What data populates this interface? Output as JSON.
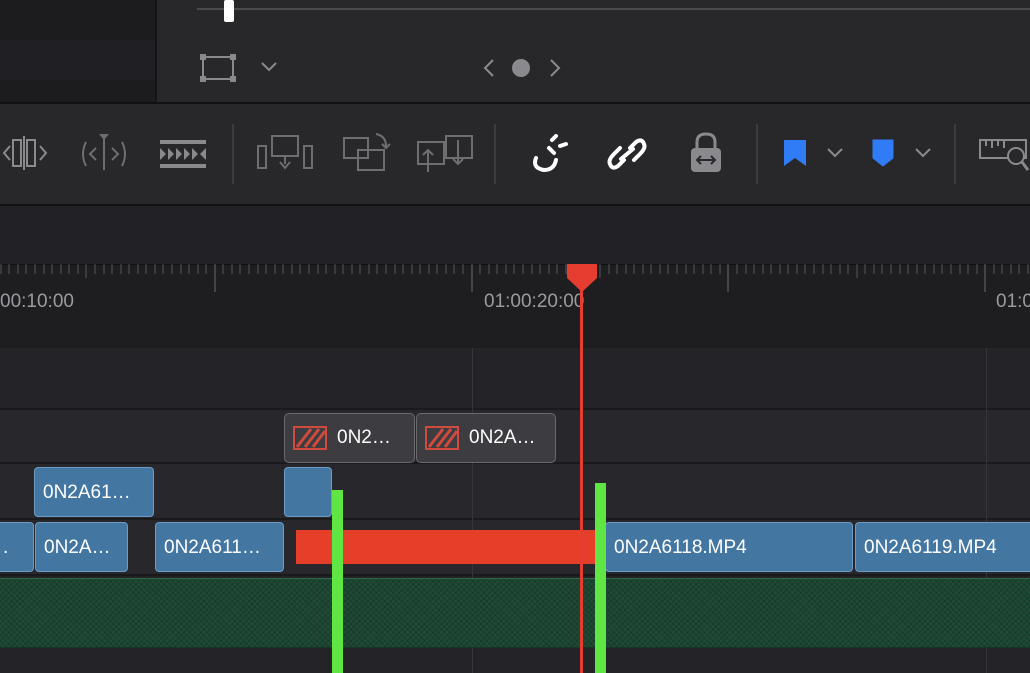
{
  "viewer": {
    "transform_icon": "transform-rect-icon",
    "dropdown_icon": "chevron-down-icon",
    "prev_icon": "chevron-left-icon",
    "dot_icon": "page-dot-icon",
    "next_icon": "chevron-right-icon"
  },
  "toolbar": {
    "tools": [
      "dynamic-trim-icon",
      "blade-trim-icon",
      "razor-blade-icon",
      "insert-clip-icon",
      "overwrite-clip-icon",
      "replace-clip-icon",
      "snapping-magnet-icon",
      "linked-selection-icon",
      "position-lock-icon",
      "flag-icon",
      "marker-icon",
      "zoom-ruler-icon"
    ],
    "flag_color": "#2f7cf6",
    "marker_color": "#2f7cf6"
  },
  "timeline": {
    "timecodes": [
      "00:10:00",
      "01:00:20:00",
      "01:0"
    ],
    "playhead_color": "#e53d30",
    "tracks": {
      "v3": {
        "clips": [
          {
            "label": "0N2…",
            "status": "offline"
          },
          {
            "label": "0N2A…",
            "status": "offline"
          }
        ]
      },
      "v2": {
        "clips": [
          {
            "label": "0N2A61…"
          },
          {
            "label": ""
          }
        ]
      },
      "v1": {
        "clips": [
          {
            "label": "."
          },
          {
            "label": "0N2A…"
          },
          {
            "label": "0N2A611…"
          },
          {
            "label": "0N2A6118.MP4"
          },
          {
            "label": "0N2A6119.MP4"
          }
        ]
      }
    },
    "clip_color": "#4476a2",
    "edit_range_color": "#e53f29",
    "edit_point_color": "#5fe645",
    "audio_color": "#1f4a36"
  }
}
